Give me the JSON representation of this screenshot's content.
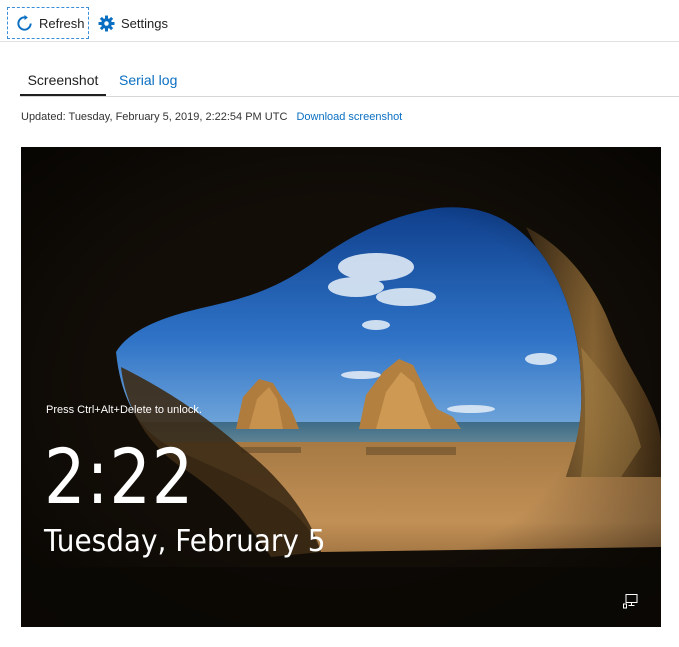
{
  "toolbar": {
    "refresh_label": "Refresh",
    "settings_label": "Settings",
    "accent_color": "#0a6fc2"
  },
  "tabs": [
    {
      "label": "Screenshot",
      "active": true
    },
    {
      "label": "Serial log",
      "active": false
    }
  ],
  "updated": {
    "text": "Updated: Tuesday, February 5, 2019, 2:22:54 PM UTC",
    "download_label": "Download screenshot"
  },
  "lock_screen": {
    "prompt": "Press Ctrl+Alt+Delete to unlock.",
    "time": "2:22",
    "date": "Tuesday, February 5",
    "status_icon": "network-icon"
  }
}
